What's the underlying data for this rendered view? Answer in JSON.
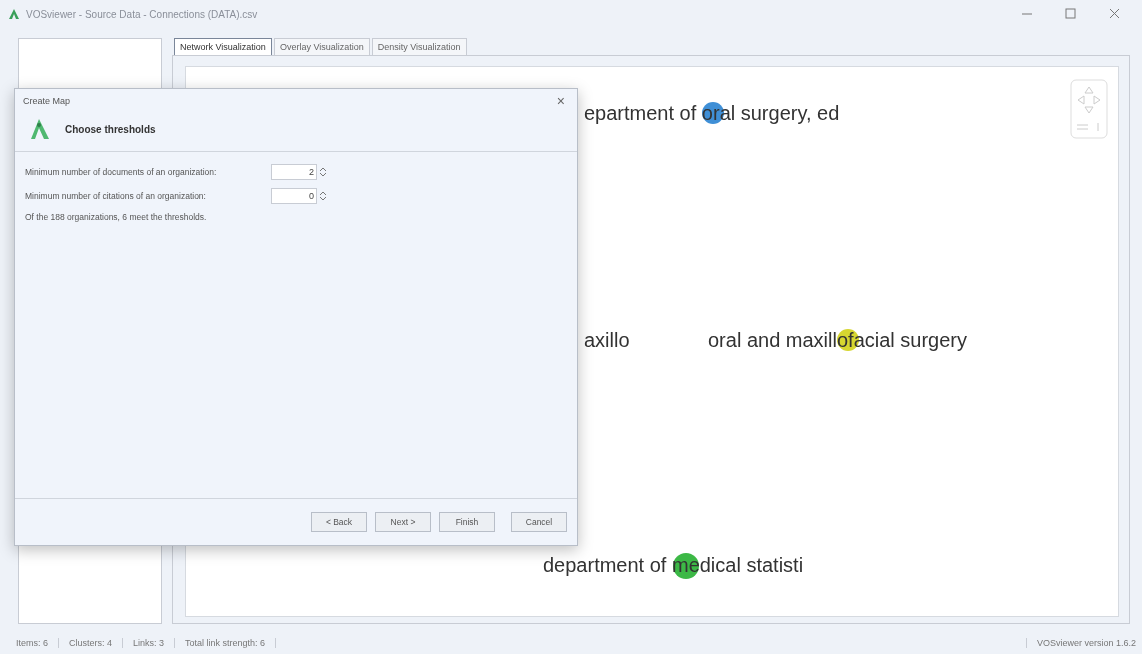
{
  "window": {
    "title": "VOSviewer - Source Data - Connections (DATA).csv"
  },
  "tabs": [
    {
      "label": "Network Visualization",
      "selected": true
    },
    {
      "label": "Overlay Visualization",
      "selected": false
    },
    {
      "label": "Density Visualization",
      "selected": false
    }
  ],
  "map": {
    "nodes": [
      {
        "label": "epartment of oral surgery, ed",
        "color": "#3f8fd6"
      },
      {
        "label": "axillo"
      },
      {
        "label": "oral and maxillofacial surgery",
        "color": "#d6d630"
      },
      {
        "label": "department of medical statisti",
        "color": "#3cb846"
      }
    ]
  },
  "dialog": {
    "title": "Create Map",
    "close": "×",
    "heading": "Choose thresholds",
    "fields": [
      {
        "label": "Minimum number of documents of an organization:",
        "value": "2"
      },
      {
        "label": "Minimum number of citations of an organization:",
        "value": "0"
      }
    ],
    "summary": "Of the 188 organizations, 6 meet the thresholds.",
    "buttons": [
      "< Back",
      "Next >",
      "Finish",
      "Cancel"
    ]
  },
  "status_bar": {
    "items": [
      "Items: 6",
      "Clusters: 4",
      "Links: 3",
      "Total link strength: 6"
    ],
    "version": "VOSviewer version 1.6.2"
  }
}
